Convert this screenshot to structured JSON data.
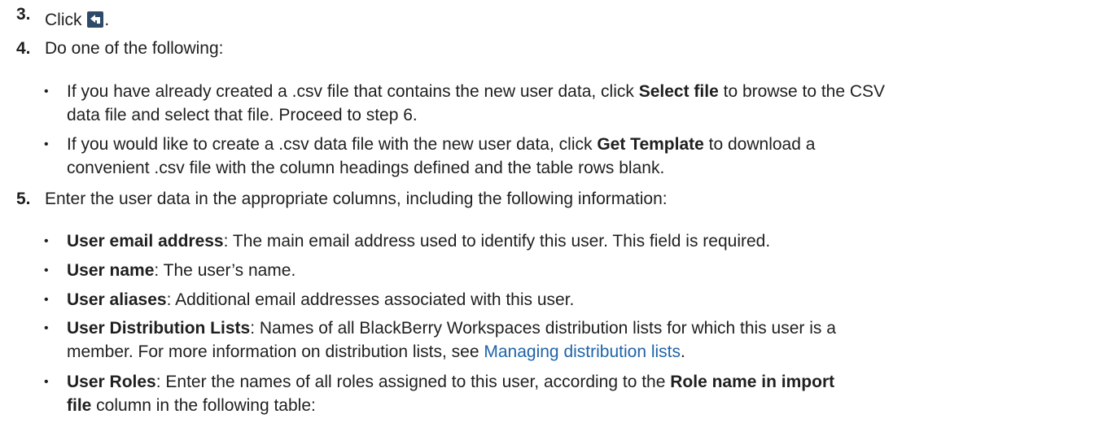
{
  "steps": [
    {
      "num": "3.",
      "text_before_icon": "Click ",
      "icon": "back-arrow-icon",
      "text_after_icon": "."
    },
    {
      "num": "4.",
      "text": "Do one of the following:"
    },
    {
      "num": "5.",
      "text": "Enter the user data in the appropriate columns, including the following information:"
    }
  ],
  "step4_bullets": [
    {
      "pre": " If you have already created a .csv file that contains the new user data, click ",
      "bold": "Select file",
      "post": " to browse to the CSV"
    },
    {
      "cont": "data file and select that file. Proceed to step 6."
    },
    {
      "pre": " If you would like to create a .csv data file with the new user data, click ",
      "bold": "Get Template",
      "post": " to download a"
    },
    {
      "cont": "convenient .csv file with the column headings defined and the table rows blank."
    }
  ],
  "step5_bullets": [
    {
      "bold": "User email address",
      "post": ": The main email address used to identify this user. This field is required."
    },
    {
      "bold": "User name",
      "post": ": The user’s name."
    },
    {
      "bold": "User aliases",
      "post": ": Additional email addresses associated with this user."
    },
    {
      "bold": "User Distribution Lists",
      "post": ": Names of all BlackBerry Workspaces distribution lists for which this user is a"
    },
    {
      "cont_pre": "member. For more information on distribution lists, see ",
      "link": "Managing distribution lists",
      "cont_post": "."
    },
    {
      "bold": "User Roles",
      "post": ": Enter the names of all roles assigned to this user, according to the ",
      "bold2": "Role name in import"
    },
    {
      "cont_bold": "file",
      "cont_post": " column in the following table:"
    }
  ],
  "bullet_char": "•",
  "colors": {
    "text": "#1f1f1f",
    "link": "#1f63a8",
    "icon_bg": "#2d4a6b",
    "icon_fg": "#ffffff"
  }
}
